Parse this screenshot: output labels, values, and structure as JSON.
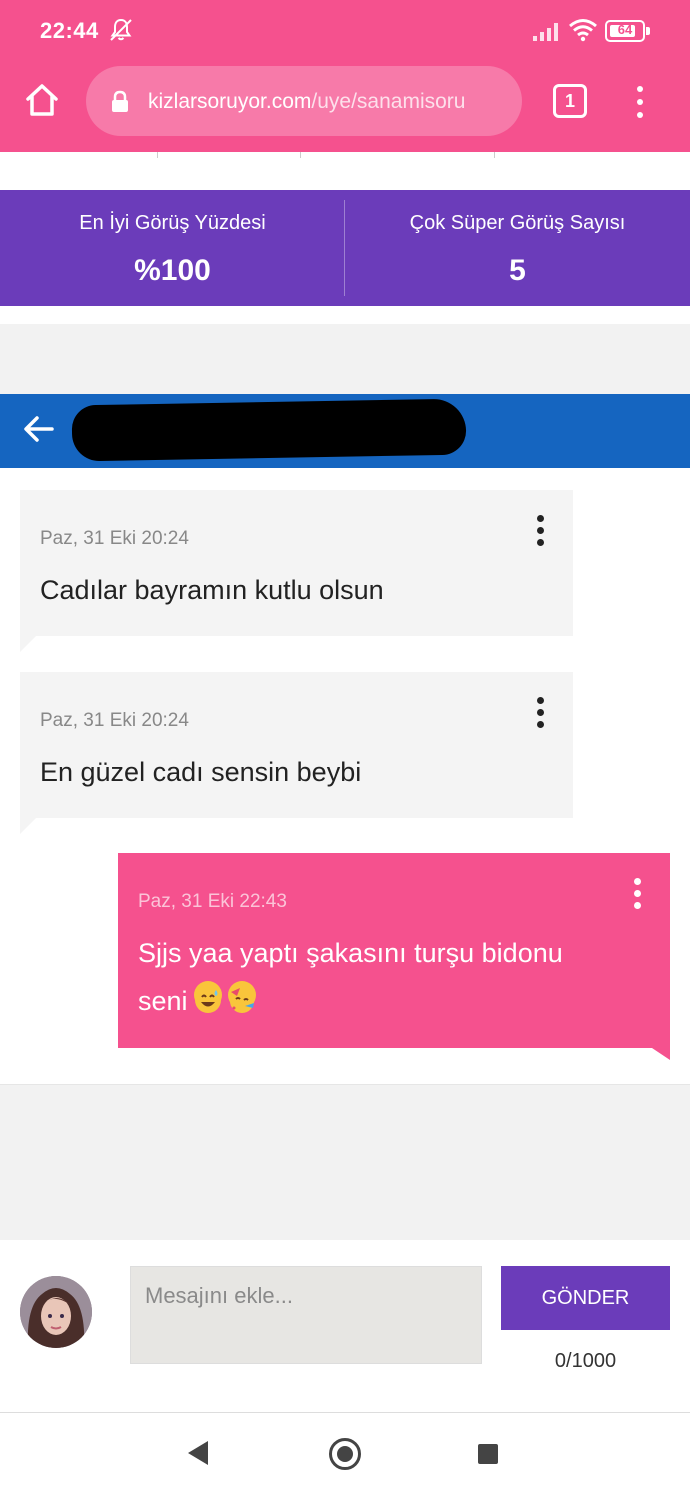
{
  "status_bar": {
    "time": "22:44",
    "battery": "64"
  },
  "browser": {
    "url_domain": "kizlarsoruyor.com",
    "url_path": "/uye/sanamisoru",
    "tab_count": "1"
  },
  "stats": [
    {
      "label": "En İyi Görüş Yüzdesi",
      "value": "%100"
    },
    {
      "label": "Çok Süper Görüş Sayısı",
      "value": "5"
    }
  ],
  "chat": {
    "name": ""
  },
  "messages": [
    {
      "direction": "incoming",
      "time": "Paz, 31 Eki 20:24",
      "text": "Cadılar bayramın kutlu olsun"
    },
    {
      "direction": "incoming",
      "time": "Paz, 31 Eki 20:24",
      "text": "En güzel cadı sensin beybi"
    },
    {
      "direction": "outgoing",
      "time": "Paz, 31 Eki 22:43",
      "text_line1": "Sjjs yaa yaptı şakasını turşu bidonu",
      "text_line2": "seni",
      "emojis": [
        "grinning-sweat-emoji",
        "face-with-party-horn-emoji"
      ]
    }
  ],
  "compose": {
    "placeholder": "Mesajını ekle...",
    "send_label": "GÖNDER",
    "counter": "0/1000"
  },
  "colors": {
    "brand_pink": "#f5518e",
    "purple": "#6b3cba",
    "blue": "#1565c0"
  }
}
